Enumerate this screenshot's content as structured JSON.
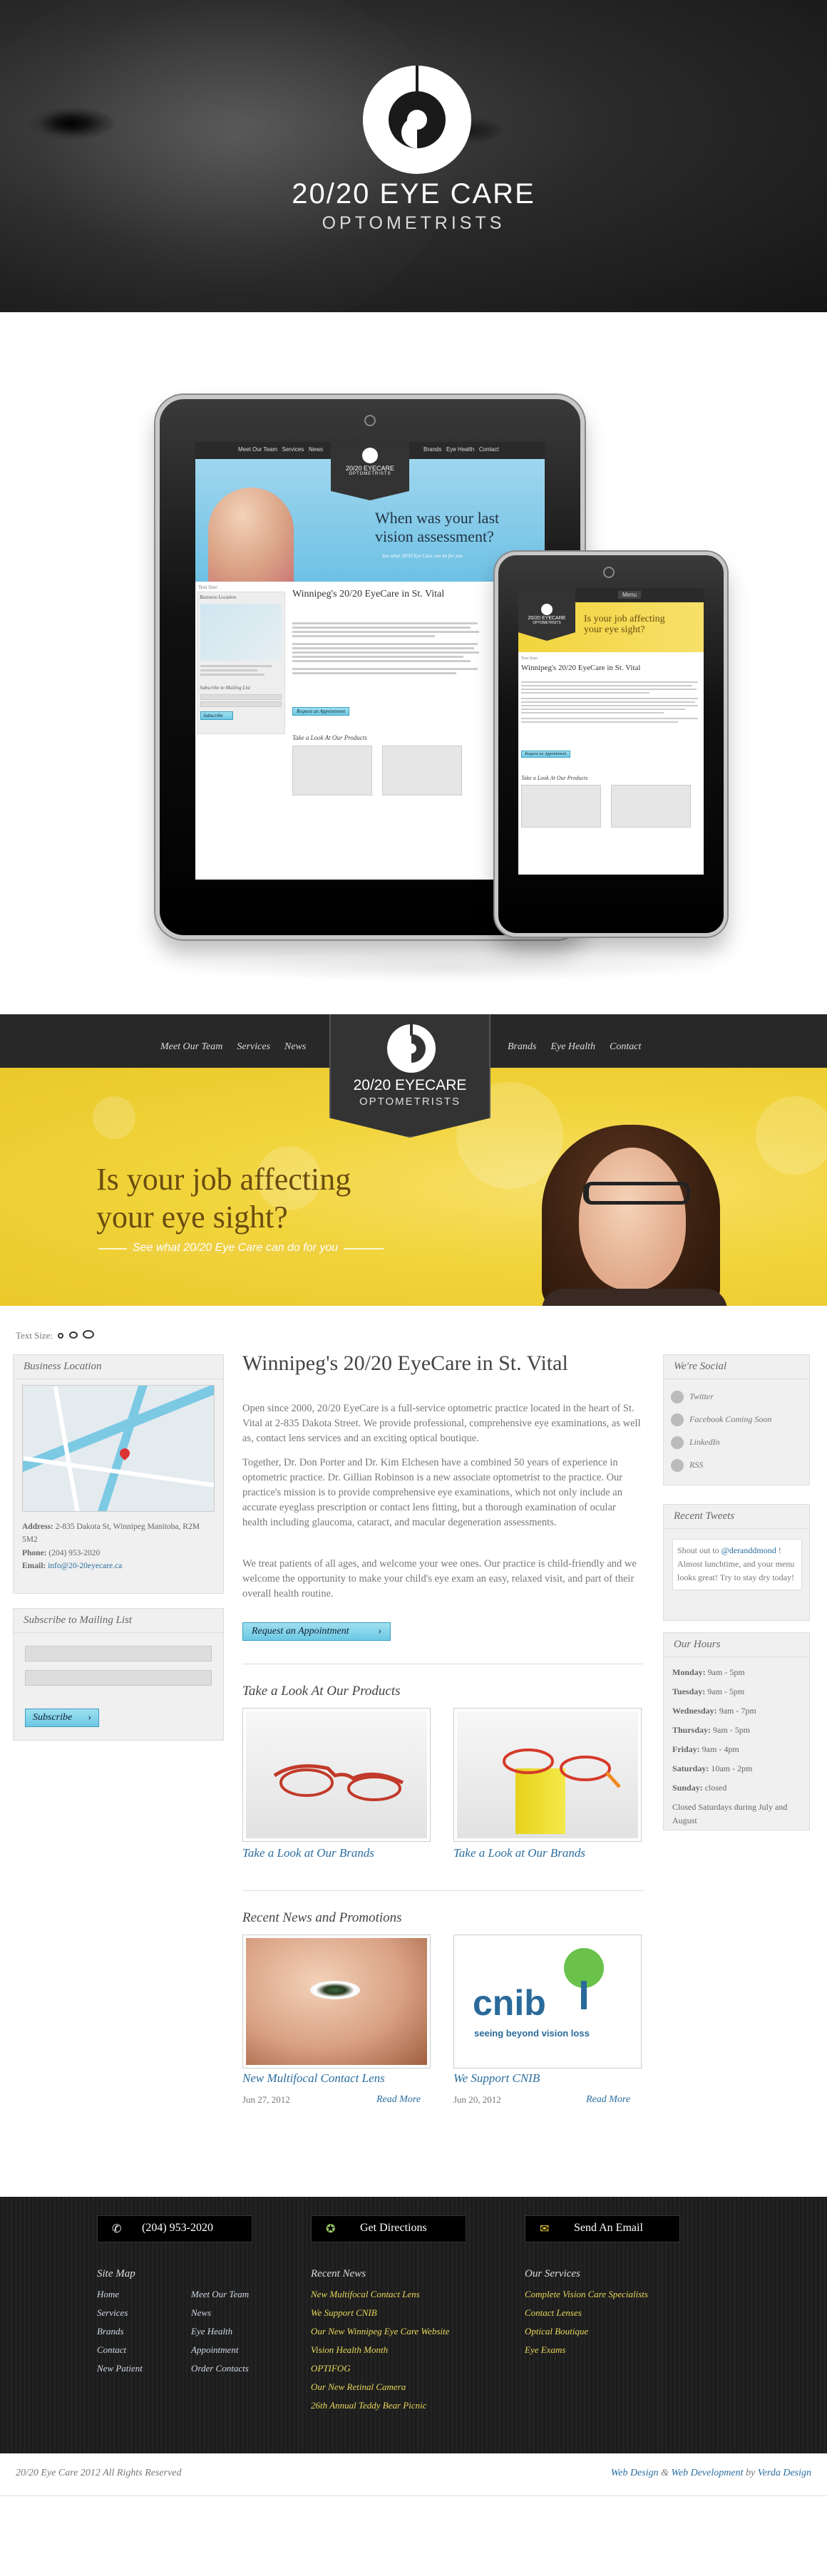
{
  "hero": {
    "title": "20/20 EYE CARE",
    "subtitle": "OPTOMETRISTS"
  },
  "mockup": {
    "tablet": {
      "nav_left": [
        "Meet Our Team",
        "Services",
        "News"
      ],
      "nav_right": [
        "Brands",
        "Eye Health",
        "Contact"
      ],
      "logo": "20/20 EYECARE",
      "logo_sub": "OPTOMETRISTS",
      "banner_line1": "When was your last",
      "banner_line2": "vision assessment?",
      "banner_cta": "See what 20/20 Eye Care can do for you",
      "heading": "Winnipeg's 20/20 EyeCare in St. Vital",
      "text_size": "Text Size:",
      "location": "Business Location",
      "mailing": "Subscribe to Mailing List",
      "subscribe": "Subscribe",
      "appointment": "Request an Appointment",
      "products": "Take a Look At Our Products"
    },
    "phone": {
      "menu": "Menu",
      "logo": "20/20 EYECARE",
      "logo_sub": "OPTOMETRISTS",
      "banner_line1": "Is your job affecting",
      "banner_line2": "your eye sight?",
      "text_size": "Text Size:",
      "heading": "Winnipeg's 20/20 EyeCare in St. Vital",
      "appointment": "Request an Appointment",
      "products": "Take a Look At Our Products"
    }
  },
  "nav": {
    "left": [
      "Meet Our Team",
      "Services",
      "News"
    ],
    "right": [
      "Brands",
      "Eye Health",
      "Contact"
    ],
    "logo": "20/20 EYECARE",
    "logo_sub": "OPTOMETRISTS"
  },
  "banner": {
    "line1": "Is your job affecting",
    "line2": "your eye sight?",
    "cta": "See what 20/20 Eye Care can do for you"
  },
  "text_size_label": "Text Size:",
  "location": {
    "title": "Business Location",
    "address_label": "Address:",
    "address": "2-835 Dakota St, Winnipeg Manitoba, R2M 5M2",
    "phone_label": "Phone:",
    "phone": "(204) 953-2020",
    "email_label": "Email:",
    "email": "info@20-20eyecare.ca"
  },
  "mailing": {
    "title": "Subscribe to Mailing List",
    "button": "Subscribe"
  },
  "main": {
    "title": "Winnipeg's 20/20 EyeCare in St. Vital",
    "p1": "Open since 2000, 20/20 EyeCare is a full-service optometric practice located in the heart of St. Vital at 2-835 Dakota Street. We provide professional, comprehensive eye examinations, as well as, contact lens services and an exciting optical boutique.",
    "p2": "Together, Dr. Don Porter and Dr. Kim Elchesen have a combined 50 years of experience in optometric practice. Dr. Gillian Robinson is a new associate optometrist to the practice. Our practice's mission is to provide comprehensive eye examinations, which not only include an accurate eyeglass prescription or contact lens fitting, but a thorough examination of ocular health including glaucoma, cataract, and macular degeneration assessments.",
    "p3": "We treat patients of all ages, and welcome your wee ones. Our practice is child-friendly and we welcome the opportunity to make your child's eye exam an easy, relaxed visit, and part of their overall health routine.",
    "appointment": "Request an Appointment",
    "products_title": "Take a Look At Our Products",
    "products": [
      {
        "label": "Take a Look at Our Brands"
      },
      {
        "label": "Take a Look at Our Brands"
      }
    ],
    "news_title": "Recent News and Promotions",
    "news": [
      {
        "title": "New Multifocal Contact Lens",
        "date": "Jun 27, 2012",
        "more": "Read More"
      },
      {
        "title": "We Support CNIB",
        "date": "Jun 20, 2012",
        "more": "Read More"
      }
    ],
    "cnib_logo": "cnib",
    "cnib_tagline": "seeing beyond vision loss"
  },
  "social": {
    "title": "We're Social",
    "items": [
      "Twitter",
      "Facebook Coming Soon",
      "LinkedIn",
      "RSS"
    ]
  },
  "tweets": {
    "title": "Recent Tweets",
    "prefix": "Shout out to ",
    "handle": "@deranddmond",
    "text": " ! Almost lunchtime, and your menu looks great! Try to stay dry today!"
  },
  "hours": {
    "title": "Our Hours",
    "rows": [
      {
        "day": "Monday:",
        "time": "9am - 5pm"
      },
      {
        "day": "Tuesday:",
        "time": "9am - 5pm"
      },
      {
        "day": "Wednesday:",
        "time": "9am - 7pm"
      },
      {
        "day": "Thursday:",
        "time": "9am - 5pm"
      },
      {
        "day": "Friday:",
        "time": "9am - 4pm"
      },
      {
        "day": "Saturday:",
        "time": "10am - 2pm"
      },
      {
        "day": "Sunday:",
        "time": "closed"
      }
    ],
    "note": "Closed Saturdays during July and August"
  },
  "footer": {
    "phone": "(204) 953-2020",
    "directions": "Get Directions",
    "email": "Send An Email",
    "sitemap_title": "Site Map",
    "sitemap_col1": [
      "Home",
      "Services",
      "Brands",
      "Contact",
      "New Patient"
    ],
    "sitemap_col2": [
      "Meet Our Team",
      "News",
      "Eye Health",
      "Appointment",
      "Order Contacts"
    ],
    "news_title": "Recent News",
    "news": [
      "New Multifocal Contact Lens",
      "We Support CNIB",
      "Our New Winnipeg Eye Care Website",
      "Vision Health Month",
      "OPTIFOG",
      "Our New Retinal Camera",
      "26th Annual Teddy Bear Picnic"
    ],
    "services_title": "Our Services",
    "services": [
      "Complete Vision Care Specialists",
      "Contact Lenses",
      "Optical Boutique",
      "Eye Exams"
    ],
    "copyright": "20/20 Eye Care 2012 All Rights Reserved",
    "credit_a": "Web Design",
    "credit_amp": " & ",
    "credit_b": "Web Development",
    "credit_by": " by ",
    "credit_c": "Verda Design"
  },
  "colors": {
    "accent_blue": "#7cd0e8",
    "link_blue": "#2a6ea0",
    "banner_yellow": "#f2d43c",
    "footer_yellow": "#e8d65a"
  }
}
